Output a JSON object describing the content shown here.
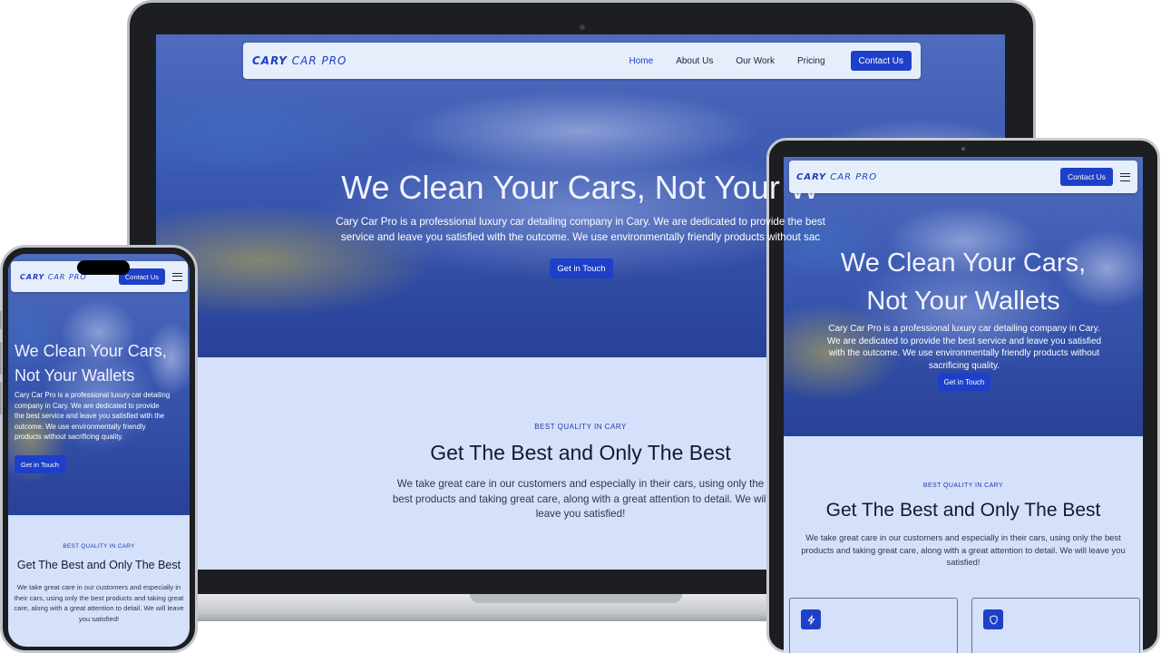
{
  "brand": {
    "logo_main": "CARY",
    "logo_rest": " CAR PRO"
  },
  "nav": {
    "links": [
      "Home",
      "About Us",
      "Our Work",
      "Pricing"
    ],
    "cta": "Contact Us"
  },
  "hero": {
    "headline_desktop": "We Clean Your Cars, Not Your W",
    "headline_line1": "We Clean Your Cars,",
    "headline_line2": "Not Your Wallets",
    "desc_desktop": "Cary Car Pro is a professional luxury car detailing company in Cary. We are dedicated to provide the best service and leave you satisfied with the outcome. We use environmentally friendly products without sac",
    "desc_full": "Cary Car Pro is a professional luxury car detailing company in Cary. We are dedicated to provide the best service and leave you satisfied with the outcome. We use environmentally friendly products without sacrificing quality.",
    "button": "Get in Touch"
  },
  "quality": {
    "eyebrow": "BEST QUALITY IN CARY",
    "title": "Get The Best and Only The Best",
    "desc_desktop": "We take great care in our customers and especially in their cars, using only the best products and taking great care, along with a great attention to detail. We will leave you satisfied!",
    "desc_full": "We take great care in our customers and especially in their cars, using only the best products and taking great care, along with a great attention to detail. We will leave you satisfied!"
  },
  "feature_cards": [
    {
      "icon": "lightning-icon"
    },
    {
      "icon": "shield-icon"
    }
  ],
  "colors": {
    "accent": "#1e40c8",
    "section_bg": "#d5e1fb",
    "nav_bg": "#e6eefc"
  }
}
